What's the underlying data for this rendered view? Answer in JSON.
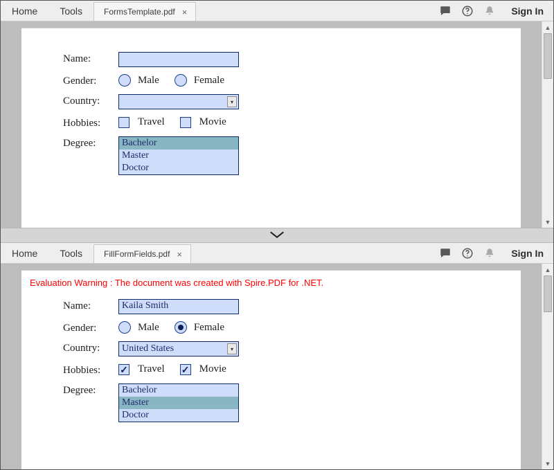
{
  "panes": [
    {
      "toolbar": {
        "home": "Home",
        "tools": "Tools",
        "signin": "Sign In",
        "tab": {
          "title": "FormsTemplate.pdf"
        }
      },
      "scroll": {
        "thumb_top_pct": 0,
        "thumb_height_pct": 25
      },
      "form": {
        "labels": {
          "name": "Name:",
          "gender": "Gender:",
          "country": "Country:",
          "hobbies": "Hobbies:",
          "degree": "Degree:"
        },
        "name_value": "",
        "gender": {
          "options": [
            {
              "label": "Male",
              "checked": false
            },
            {
              "label": "Female",
              "checked": false
            }
          ]
        },
        "country_value": "",
        "hobbies": {
          "options": [
            {
              "label": "Travel",
              "checked": false
            },
            {
              "label": "Movie",
              "checked": false
            }
          ]
        },
        "degree": {
          "options": [
            {
              "label": "Bachelor",
              "selected": true
            },
            {
              "label": "Master",
              "selected": false
            },
            {
              "label": "Doctor",
              "selected": false
            }
          ]
        }
      }
    },
    {
      "toolbar": {
        "home": "Home",
        "tools": "Tools",
        "signin": "Sign In",
        "tab": {
          "title": "FillFormFields.pdf"
        }
      },
      "scroll": {
        "thumb_top_pct": 0,
        "thumb_height_pct": 20
      },
      "warning": "Evaluation Warning : The document was created with Spire.PDF for .NET.",
      "form": {
        "labels": {
          "name": "Name:",
          "gender": "Gender:",
          "country": "Country:",
          "hobbies": "Hobbies:",
          "degree": "Degree:"
        },
        "name_value": "Kaila Smith",
        "gender": {
          "options": [
            {
              "label": "Male",
              "checked": false
            },
            {
              "label": "Female",
              "checked": true
            }
          ]
        },
        "country_value": "United States",
        "hobbies": {
          "options": [
            {
              "label": "Travel",
              "checked": true
            },
            {
              "label": "Movie",
              "checked": true
            }
          ]
        },
        "degree": {
          "options": [
            {
              "label": "Bachelor",
              "selected": false
            },
            {
              "label": "Master",
              "selected": true
            },
            {
              "label": "Doctor",
              "selected": false
            }
          ]
        }
      }
    }
  ]
}
